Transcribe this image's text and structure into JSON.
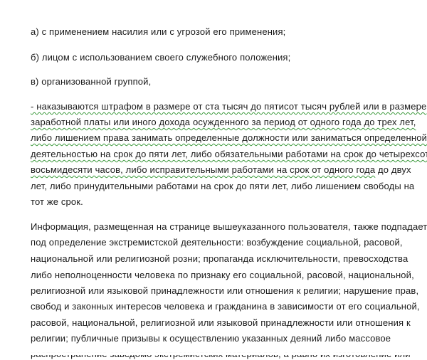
{
  "document": {
    "list_items": [
      "а) с применением насилия или с угрозой его применения;",
      "б) лицом с использованием своего служебного положения;",
      "в) организованной группой,"
    ],
    "penalty_lines": [
      {
        "underlined": "- наказываются штрафом в размере от ста тысяч до пятисот тысяч рублей или в размере",
        "plain": ""
      },
      {
        "underlined": "заработной платы или иного дохода осужденного за период от одного года до трех лет,",
        "plain": ""
      },
      {
        "underlined": "либо лишением права занимать определенные должности или заниматься определенной",
        "plain": ""
      },
      {
        "underlined": "деятельностью на срок до пяти лет, либо обязательными работами на срок до четырехсот",
        "plain": ""
      },
      {
        "underlined": "восьмидесяти часов, либо исправительными работами на срок от одного года",
        "plain": " до двух"
      },
      {
        "underlined": "",
        "plain": "лет, либо принудительными работами на срок до пяти лет, либо лишением свободы на"
      },
      {
        "underlined": "",
        "plain": "тот же срок."
      }
    ],
    "info_lines": [
      "Информация, размещенная на странице вышеуказанного пользователя, также подпадает",
      "под определение экстремистской деятельности: возбуждение социальной, расовой,",
      "национальной или религиозной розни; пропаганда исключительности, превосходства",
      "либо неполноценности человека по признаку его социальной, расовой, национальной,",
      "религиозной или языковой принадлежности или отношения к религии; нарушение прав,",
      "свобод и законных интересов человека и гражданина в зависимости от его социальной,",
      "расовой, национальной, религиозной или языковой принадлежности или отношения к",
      "религии; публичные призывы к осуществлению указанных деяний либо массовое",
      "распространение заведомо экстремистских материалов, а равно их изготовление или"
    ],
    "colors": {
      "text": "#1a1a1a",
      "spellcheck_underline": "#3c9a3c",
      "background": "#ffffff"
    }
  }
}
